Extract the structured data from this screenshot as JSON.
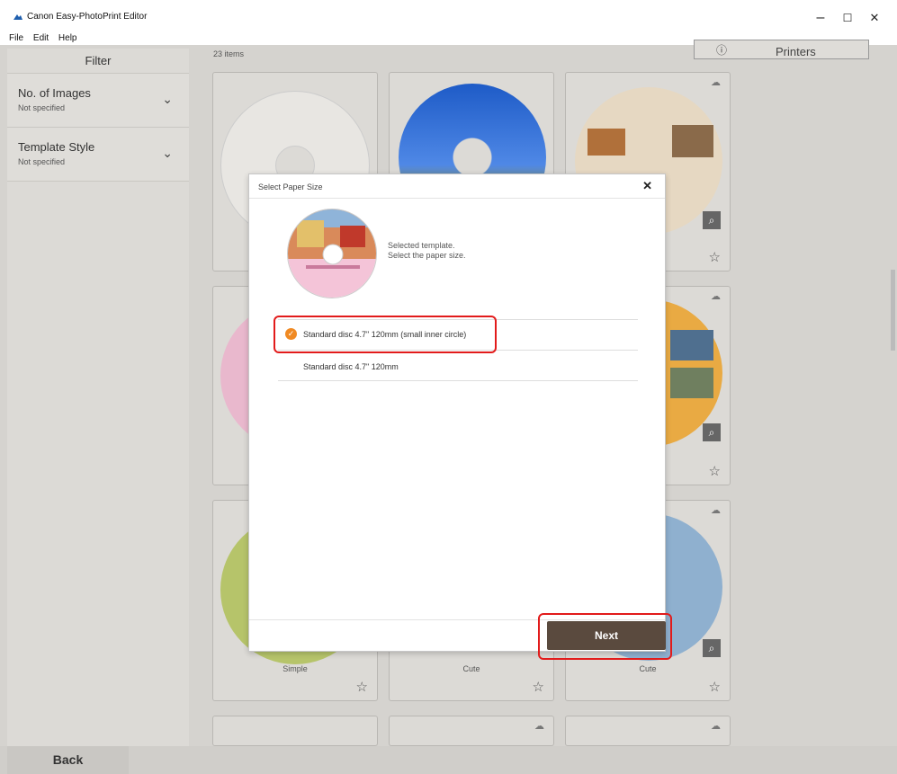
{
  "app": {
    "title": "Canon Easy-PhotoPrint Editor"
  },
  "menu": [
    "File",
    "Edit",
    "Help"
  ],
  "window_controls": {
    "minimize": "–",
    "maximize": "☐",
    "close": "✕"
  },
  "sidebar": {
    "header": "Filter",
    "filters": [
      {
        "title": "No. of Images",
        "value": "Not specified"
      },
      {
        "title": "Template Style",
        "value": "Not specified"
      }
    ]
  },
  "main": {
    "items_count": "23 items",
    "printers_label": "Printers",
    "card_captions": [
      "Simple",
      "Cute",
      "Cute"
    ]
  },
  "dialog": {
    "title": "Select Paper Size",
    "close": "✕",
    "desc_line1": "Selected template.",
    "desc_line2": "Select the paper size.",
    "options": [
      {
        "label": "Standard disc 4.7\" 120mm (small inner circle)",
        "selected": true
      },
      {
        "label": "Standard disc 4.7\" 120mm",
        "selected": false
      }
    ],
    "next_label": "Next"
  },
  "footer": {
    "back_label": "Back"
  },
  "colors": {
    "accent": "#f08a23",
    "next_button": "#5a4a3e",
    "highlight": "#e21b1b",
    "workspace": "#d5d3cf"
  }
}
